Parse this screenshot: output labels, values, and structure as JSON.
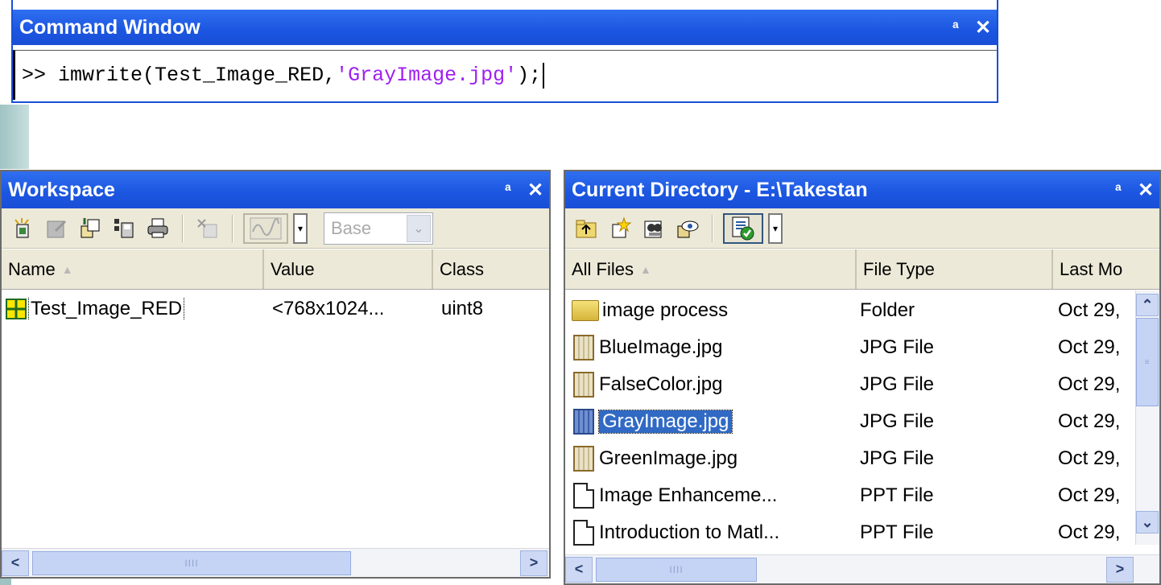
{
  "command_window": {
    "title": "Command Window",
    "undock_glyph": "ᵃ",
    "close_glyph": "✕",
    "prompt": ">>",
    "code_prefix": " imwrite(Test_Image_RED,",
    "code_string": "'GrayImage.jpg'",
    "code_suffix": ");"
  },
  "workspace": {
    "title": "Workspace",
    "undock_glyph": "ᵃ",
    "close_glyph": "✕",
    "base_combo": "Base",
    "columns": {
      "name": "Name",
      "value": "Value",
      "class": "Class"
    },
    "variables": [
      {
        "name": "Test_Image_RED",
        "value": "<768x1024...",
        "class": "uint8"
      }
    ],
    "scroll_thumb_grip": "IIII"
  },
  "current_directory": {
    "title": "Current Directory - E:\\Takestan",
    "undock_glyph": "ᵃ",
    "close_glyph": "✕",
    "columns": {
      "all_files": "All Files",
      "file_type": "File Type",
      "last_modified": "Last Mo"
    },
    "files": [
      {
        "name": "image process",
        "type": "Folder",
        "modified": "Oct 29,",
        "icon": "folder-icon"
      },
      {
        "name": "BlueImage.jpg",
        "type": "JPG File",
        "modified": "Oct 29,",
        "icon": "jpg-icon"
      },
      {
        "name": "FalseColor.jpg",
        "type": "JPG File",
        "modified": "Oct 29,",
        "icon": "jpg-icon"
      },
      {
        "name": "GrayImage.jpg",
        "type": "JPG File",
        "modified": "Oct 29,",
        "icon": "jpg-icon"
      },
      {
        "name": "GreenImage.jpg",
        "type": "JPG File",
        "modified": "Oct 29,",
        "icon": "jpg-icon"
      },
      {
        "name": "Image Enhanceme...",
        "type": "PPT File",
        "modified": "Oct 29,",
        "icon": "ppt-icon"
      },
      {
        "name": "Introduction to Matl...",
        "type": "PPT File",
        "modified": "Oct 29,",
        "icon": "ppt-icon"
      }
    ],
    "scroll_thumb_grip": "IIII"
  },
  "colors": {
    "titlebar": "#1b55e0",
    "selection": "#316ac5",
    "string_literal": "#a020f0",
    "toolbar_bg": "#ece9d8"
  }
}
